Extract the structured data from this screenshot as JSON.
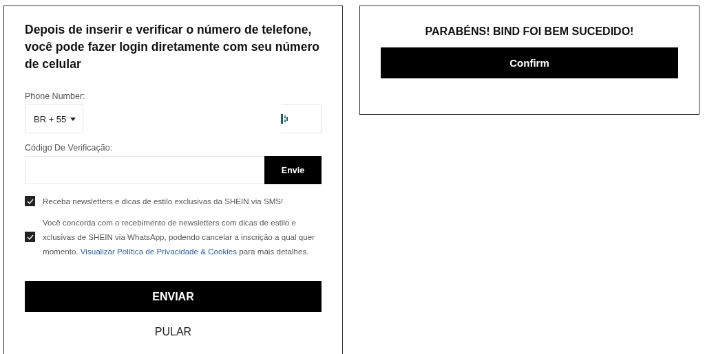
{
  "login_panel": {
    "title": "Depois de inserir e verificar o número de telefone, você pode fazer login diretamente com seu número de celular",
    "phone": {
      "label": "Phone Number:",
      "country_code": "BR + 55"
    },
    "code": {
      "label": "Código De Verificação:",
      "send_button": "Envie"
    },
    "consents": [
      {
        "checked": true,
        "text": "Receba newsletters e dicas de estilo exclusivas da SHEIN via SMS!"
      },
      {
        "checked": true,
        "text": "Você concorda com o recebimento de newsletters com dicas de estilo e xclusivas de SHEIN via WhatsApp, podendo cancelar a inscrição a qual quer momento.",
        "link": "Visualizar Política de Privacidade & Cookies",
        "text_after": "para mais detalhes."
      }
    ],
    "submit_button": "ENVIAR",
    "skip_link": "PULAR"
  },
  "success_panel": {
    "message": "PARABÉNS! BIND FOI BEM SUCEDIDO!",
    "confirm_button": "Confirm"
  }
}
